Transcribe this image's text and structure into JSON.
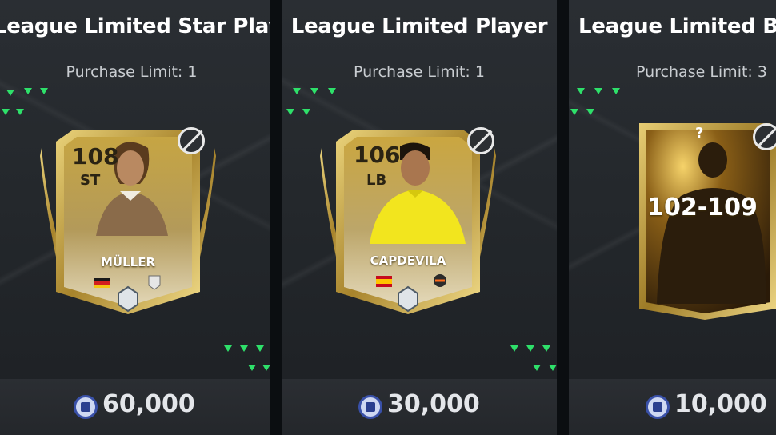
{
  "offers": [
    {
      "title": "League Limited Star Player",
      "purchase_limit": "Purchase Limit: 1",
      "card": {
        "rating": "108",
        "position": "ST",
        "name": "MÜLLER"
      },
      "price": "60,000",
      "coin_icon": "coin-icon",
      "untradeable_icon": "untradeable-icon"
    },
    {
      "title": "League Limited Player",
      "purchase_limit": "Purchase Limit: 1",
      "card": {
        "rating": "106",
        "position": "LB",
        "name": "CAPDEVILA"
      },
      "price": "30,000",
      "coin_icon": "coin-icon",
      "untradeable_icon": "untradeable-icon"
    },
    {
      "title": "League Limited Bu",
      "purchase_limit": "Purchase Limit: 3",
      "card": {
        "range": "102-109",
        "mystery": "?"
      },
      "price": "10,000",
      "coin_icon": "coin-icon",
      "untradeable_icon": "untradeable-icon"
    }
  ],
  "colors": {
    "accent_green": "#2ee06a",
    "gold": "#c9a94a",
    "coin_blue": "#3950a8"
  }
}
